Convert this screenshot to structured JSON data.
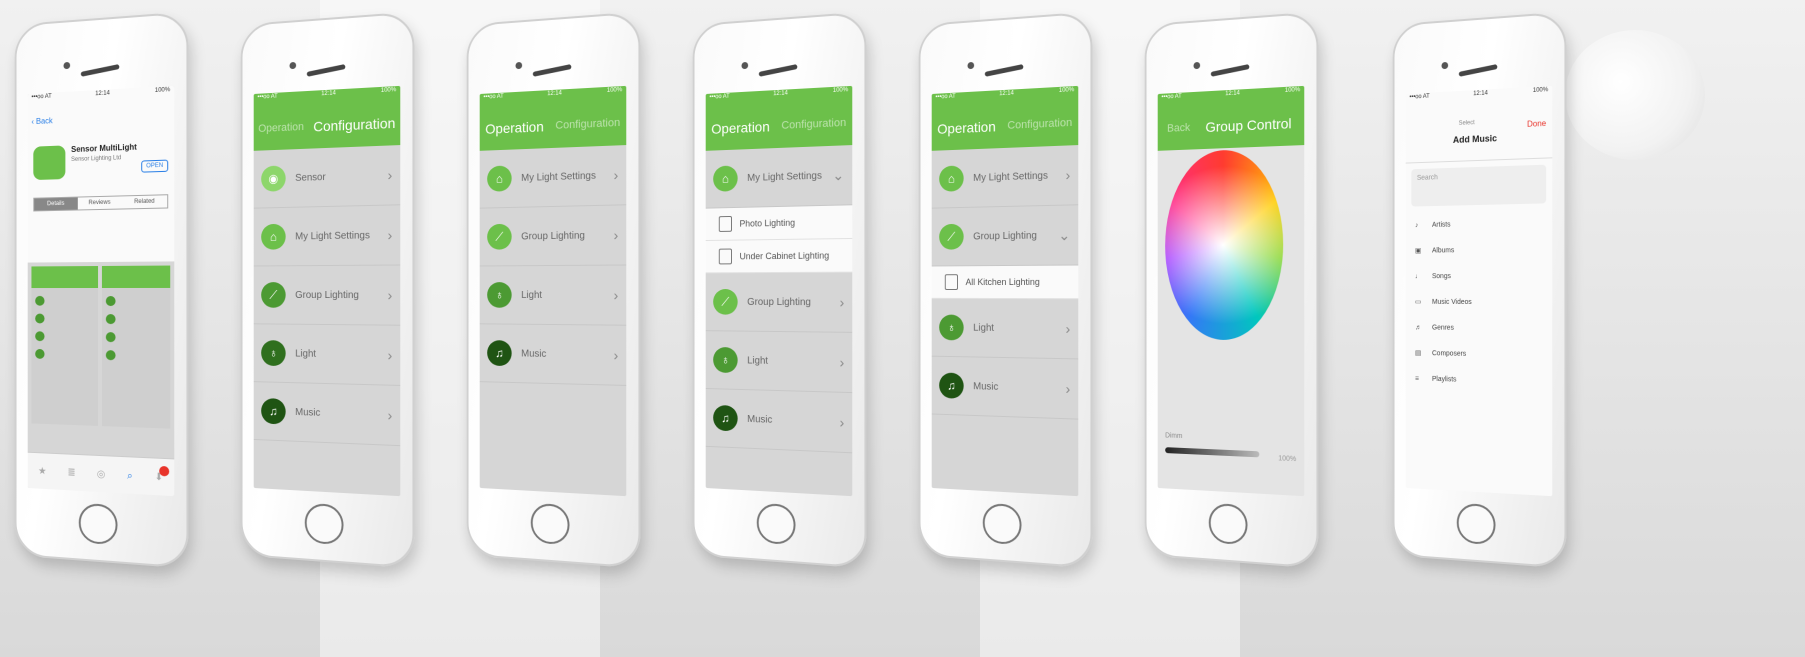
{
  "colors": {
    "accent": "#6cc04a",
    "dark_green": "#2f6f1e",
    "ios_blue": "#2a7fe6",
    "red": "#e8332a"
  },
  "status": {
    "carrier": "•••oo AT",
    "time": "12:14",
    "battery": "100%"
  },
  "phone1": {
    "back": "‹ Back",
    "app_name": "Sensor MultiLight",
    "app_sub": "Sensor Lighting Ltd",
    "open": "OPEN",
    "segments": [
      "Details",
      "Reviews",
      "Related"
    ],
    "tabbar": [
      "Featured",
      "Top Charts",
      "Explore",
      "Search",
      "Updates"
    ]
  },
  "phone2": {
    "nav": {
      "left": "Operation",
      "right": "Configuration"
    },
    "rows": [
      {
        "icon": "bulb-icon",
        "glyph": "◉",
        "label": "Sensor"
      },
      {
        "icon": "house-icon",
        "glyph": "⌂",
        "label": "My Light Settings"
      },
      {
        "icon": "group-icon",
        "glyph": "⟋",
        "label": "Group Lighting"
      },
      {
        "icon": "bulb-icon",
        "glyph": "♁",
        "label": "Light"
      },
      {
        "icon": "music-icon",
        "glyph": "♫",
        "label": "Music"
      }
    ]
  },
  "phone3": {
    "nav": {
      "left": "Operation",
      "right": "Configuration"
    },
    "rows": [
      {
        "icon": "house-icon",
        "glyph": "⌂",
        "label": "My Light Settings"
      },
      {
        "icon": "group-icon",
        "glyph": "⟋",
        "label": "Group Lighting"
      },
      {
        "icon": "bulb-icon",
        "glyph": "♁",
        "label": "Light"
      },
      {
        "icon": "music-icon",
        "glyph": "♫",
        "label": "Music"
      }
    ]
  },
  "phone4": {
    "nav": {
      "left": "Operation",
      "right": "Configuration"
    },
    "row_top": {
      "icon": "house-icon",
      "glyph": "⌂",
      "label": "My Light Settings"
    },
    "subrows": [
      "Photo Lighting",
      "Under Cabinet Lighting"
    ],
    "rows": [
      {
        "icon": "group-icon",
        "glyph": "⟋",
        "label": "Group Lighting"
      },
      {
        "icon": "bulb-icon",
        "glyph": "♁",
        "label": "Light"
      },
      {
        "icon": "music-icon",
        "glyph": "♫",
        "label": "Music"
      }
    ]
  },
  "phone5": {
    "nav": {
      "left": "Operation",
      "right": "Configuration"
    },
    "row_a": {
      "icon": "house-icon",
      "glyph": "⌂",
      "label": "My Light Settings"
    },
    "row_b": {
      "icon": "group-icon",
      "glyph": "⟋",
      "label": "Group Lighting"
    },
    "subrows": [
      "All Kitchen Lighting"
    ],
    "rows": [
      {
        "icon": "bulb-icon",
        "glyph": "♁",
        "label": "Light"
      },
      {
        "icon": "music-icon",
        "glyph": "♫",
        "label": "Music"
      }
    ]
  },
  "phone6": {
    "nav": {
      "back": "Back",
      "title": "Group Control"
    },
    "slider_label": "Dimm",
    "slider_pct": "100%"
  },
  "phone7": {
    "top_small": "Select",
    "title": "Add Music",
    "done": "Done",
    "search_placeholder": "Search",
    "items": [
      {
        "icon": "mic-icon",
        "glyph": "♪",
        "label": "Artists"
      },
      {
        "icon": "album-icon",
        "glyph": "▣",
        "label": "Albums"
      },
      {
        "icon": "note-icon",
        "glyph": "♩",
        "label": "Songs"
      },
      {
        "icon": "video-icon",
        "glyph": "▭",
        "label": "Music Videos"
      },
      {
        "icon": "genre-icon",
        "glyph": "♬",
        "label": "Genres"
      },
      {
        "icon": "composer-icon",
        "glyph": "▤",
        "label": "Composers"
      },
      {
        "icon": "playlist-icon",
        "glyph": "≡",
        "label": "Playlists"
      }
    ]
  }
}
